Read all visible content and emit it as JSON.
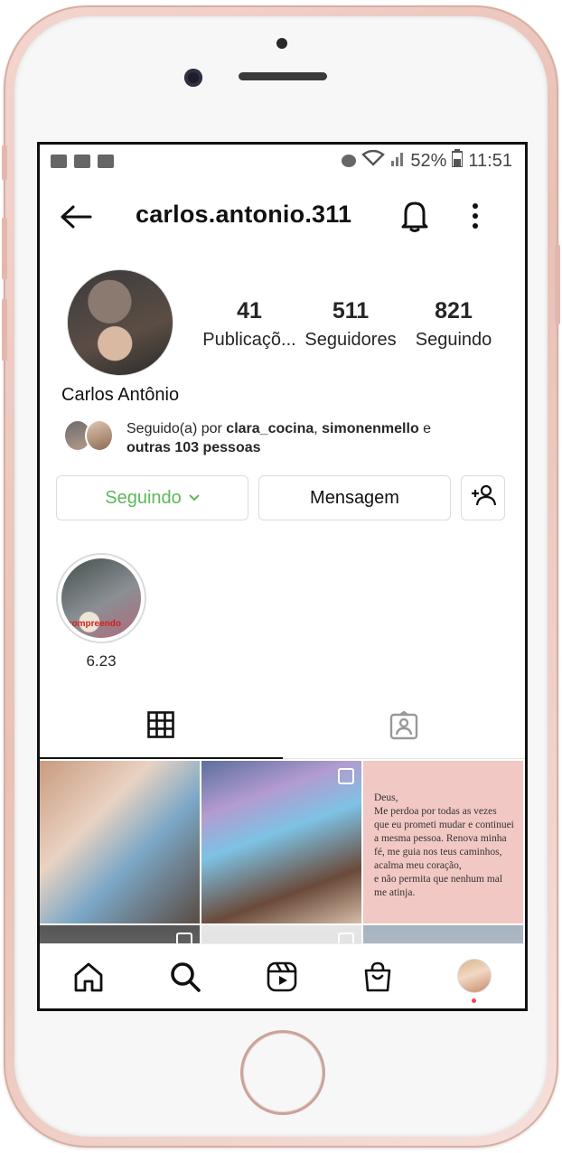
{
  "status_bar": {
    "battery": "52%",
    "time": "11:51"
  },
  "header": {
    "username": "carlos.antonio.311"
  },
  "profile": {
    "full_name": "Carlos Antônio",
    "stats": [
      {
        "value": "41",
        "label": "Publicaçõ..."
      },
      {
        "value": "511",
        "label": "Seguidores"
      },
      {
        "value": "821",
        "label": "Seguindo"
      }
    ],
    "followed_by": {
      "prefix": "Seguido(a) por ",
      "user1": "clara_cocina",
      "sep": ", ",
      "user2": "simonenmello",
      "and": " e",
      "others": "outras 103 pessoas"
    }
  },
  "actions": {
    "following_label": "Seguindo",
    "message_label": "Mensagem"
  },
  "highlights": [
    {
      "label": "6.23",
      "caption": "compreendo"
    }
  ],
  "posts": {
    "quote_lines": [
      "Deus,",
      "Me perdoa por todas as vezes",
      "que eu prometi mudar e continuei",
      "a mesma pessoa. Renova minha",
      "fé, me guia nos teus caminhos,",
      "acalma meu coração,",
      "e não permita que nenhum mal",
      "me atinja."
    ]
  },
  "icons": {
    "back": "arrow-left-icon",
    "bell": "bell-icon",
    "more": "more-vertical-icon",
    "grid": "grid-icon",
    "tagged": "tagged-icon",
    "home": "home-icon",
    "search": "search-icon",
    "reels": "reels-icon",
    "shop": "shop-icon"
  },
  "colors": {
    "following_accent": "#5cb85c",
    "notification_dot": "#ed4956"
  }
}
